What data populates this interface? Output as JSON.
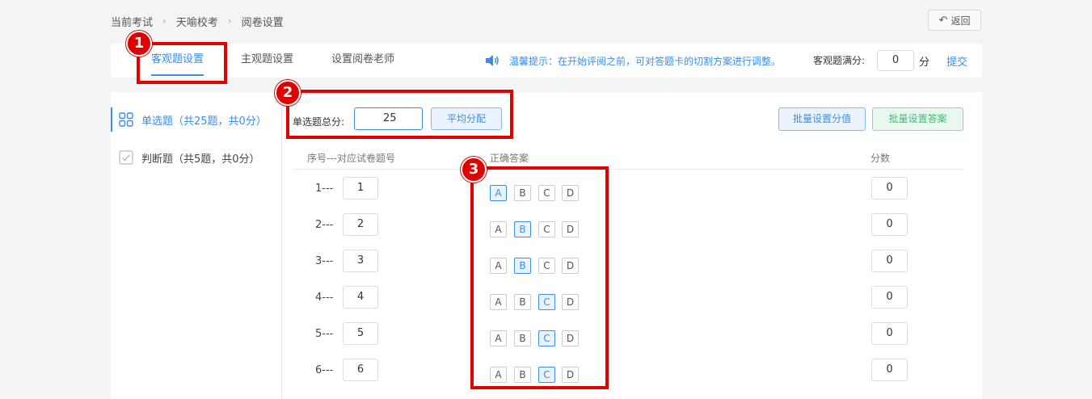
{
  "breadcrumb": [
    "当前考试",
    "天喻校考",
    "阅卷设置"
  ],
  "back_label": "返回",
  "tabs": [
    {
      "label": "客观题设置",
      "active": true
    },
    {
      "label": "主观题设置",
      "active": false
    },
    {
      "label": "设置阅卷老师",
      "active": false
    }
  ],
  "tip_text": "温馨提示：在开始评阅之前，可对答题卡的切割方案进行调整。",
  "full_score_label": "客观题满分:",
  "full_score_value": "0",
  "full_score_unit": "分",
  "submit_label": "提交",
  "sidebar": [
    {
      "label": "单选题（共25题，共0分）",
      "active": true,
      "icon": "grid-icon"
    },
    {
      "label": "判断题（共5题，共0分）",
      "active": false,
      "icon": "check-icon"
    }
  ],
  "total_label": "单选题总分:",
  "total_value": "25",
  "avg_label": "平均分配",
  "batch_score_label": "批量设置分值",
  "batch_answer_label": "批量设置答案",
  "columns": {
    "seq": "序号---对应试卷题号",
    "answer": "正确答案",
    "score": "分数"
  },
  "options": [
    "A",
    "B",
    "C",
    "D"
  ],
  "rows": [
    {
      "seq": "1---",
      "qno": "1",
      "answer": "A",
      "score": "0"
    },
    {
      "seq": "2---",
      "qno": "2",
      "answer": "B",
      "score": "0"
    },
    {
      "seq": "3---",
      "qno": "3",
      "answer": "B",
      "score": "0"
    },
    {
      "seq": "4---",
      "qno": "4",
      "answer": "C",
      "score": "0"
    },
    {
      "seq": "5---",
      "qno": "5",
      "answer": "C",
      "score": "0"
    },
    {
      "seq": "6---",
      "qno": "6",
      "answer": "C",
      "score": "0"
    }
  ],
  "annotations": [
    "1",
    "2",
    "3"
  ],
  "colors": {
    "accent": "#3a8ee6",
    "annotation": "#e00000",
    "green": "#47b97a"
  }
}
